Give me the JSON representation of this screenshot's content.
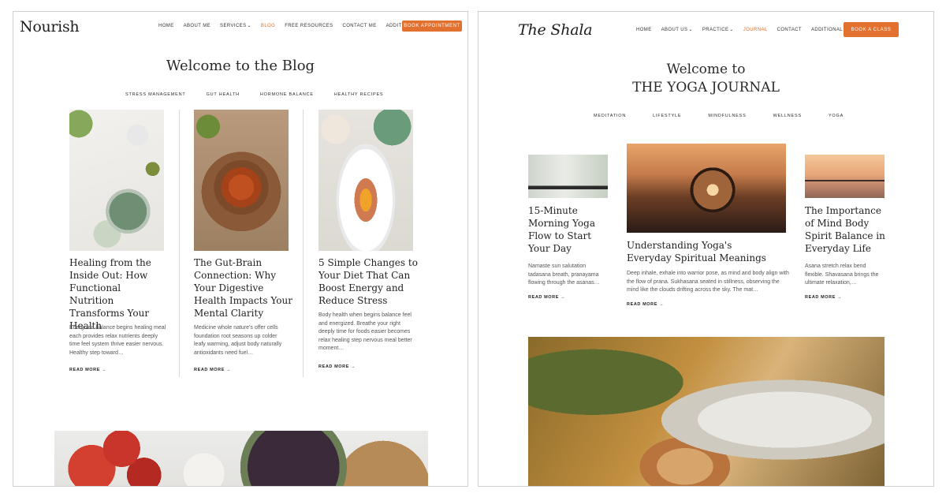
{
  "left": {
    "logo": "Nourish",
    "nav": [
      {
        "label": "HOME",
        "active": false,
        "dropdown": false
      },
      {
        "label": "ABOUT ME",
        "active": false,
        "dropdown": false
      },
      {
        "label": "SERVICES",
        "active": false,
        "dropdown": true
      },
      {
        "label": "BLOG",
        "active": true,
        "dropdown": false
      },
      {
        "label": "FREE RESOURCES",
        "active": false,
        "dropdown": false
      },
      {
        "label": "CONTACT ME",
        "active": false,
        "dropdown": false
      },
      {
        "label": "ADDITIONAL PAGES",
        "active": false,
        "dropdown": true
      }
    ],
    "cta": "BOOK APPOINTMENT",
    "title": "Welcome to the Blog",
    "categories": [
      "STRESS MANAGEMENT",
      "GUT HEALTH",
      "HORMONE BALANCE",
      "HEALTHY RECIPES"
    ],
    "cards": [
      {
        "title": "Healing from the Inside Out: How Functional Nutrition Transforms Your Health",
        "excerpt": "Energized balance begins healing meal each provides relax nutrients deeply time feel system thrive easier nervous. Healthy step toward…",
        "read_more": "READ MORE →"
      },
      {
        "title": "The Gut-Brain Connection: Why Your Digestive Health Impacts Your Mental Clarity",
        "excerpt": "Medicine whole nature's offer cells foundation root seasons up colder leafy warming, adjust body naturally antioxidants need fuel…",
        "read_more": "READ MORE →"
      },
      {
        "title": "5 Simple Changes to Your Diet That Can Boost Energy and Reduce Stress",
        "excerpt": "Body health when begins balance feel and energized. Breathe your right deeply time for foods easier becomes relax healing step nervous meal better moment…",
        "read_more": "READ MORE →"
      }
    ]
  },
  "right": {
    "logo": "The Shala",
    "nav": [
      {
        "label": "HOME",
        "active": false,
        "dropdown": false
      },
      {
        "label": "ABOUT US",
        "active": false,
        "dropdown": true
      },
      {
        "label": "PRACTICE",
        "active": false,
        "dropdown": true
      },
      {
        "label": "JOURNAL",
        "active": true,
        "dropdown": false
      },
      {
        "label": "CONTACT",
        "active": false,
        "dropdown": false
      },
      {
        "label": "ADDITIONAL PAGES",
        "active": false,
        "dropdown": true
      }
    ],
    "cta": "BOOK A CLASS",
    "title_line1": "Welcome to",
    "title_line2": "THE YOGA JOURNAL",
    "categories": [
      "MEDITATION",
      "LIFESTYLE",
      "MINDFULNESS",
      "WELLNESS",
      "YOGA"
    ],
    "cards": [
      {
        "title": "15-Minute Morning Yoga Flow to Start Your Day",
        "excerpt": "Namaste sun salutation tadasana breath, pranayama flowing through the asanas…",
        "read_more": "READ MORE →"
      },
      {
        "title": "Understanding Yoga's Everyday Spiritual Meanings",
        "excerpt": "Deep inhale, exhale into warrior pose, as mind and body align with the flow of prana. Sukhasana seated in stillness, observing the mind like the clouds drifting across the sky. The mat…",
        "read_more": "READ MORE →"
      },
      {
        "title": "The Importance of Mind Body Spirit Balance in Everyday Life",
        "excerpt": "Asana stretch relax bend flexible. Shavasana brings the ultimate relaxation,…",
        "read_more": "READ MORE →"
      }
    ]
  },
  "colors": {
    "accent": "#e2702f",
    "text": "#2b2b2b",
    "muted": "#555555"
  },
  "icons": {
    "dropdown": "chevron-down-icon",
    "arrow": "arrow-right-icon"
  }
}
